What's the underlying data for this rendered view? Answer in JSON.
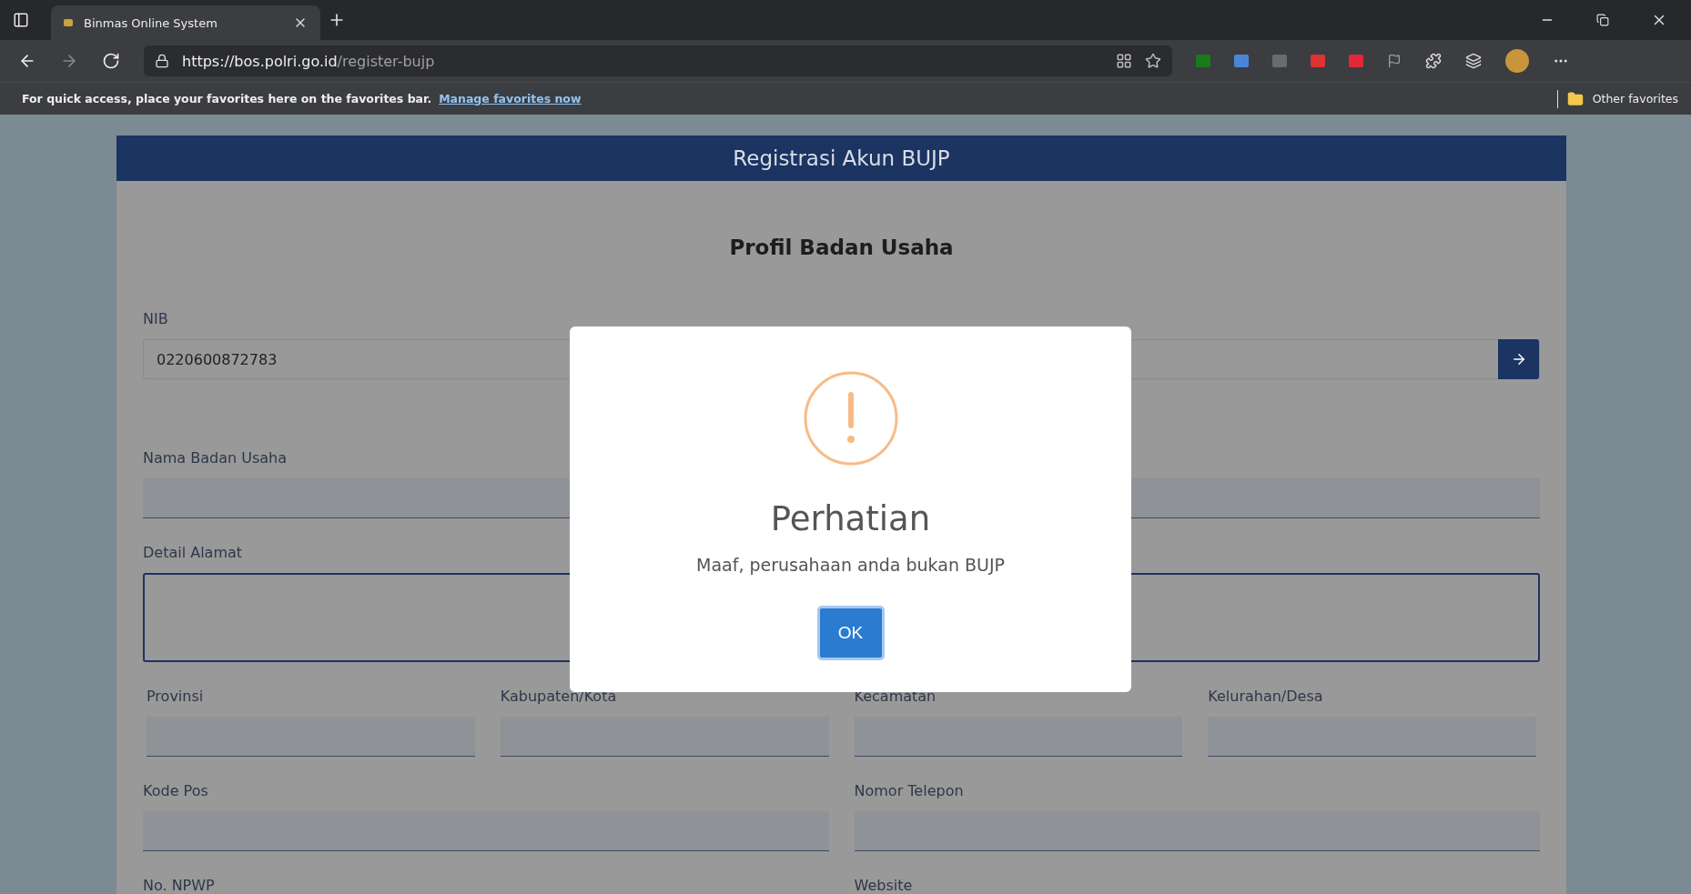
{
  "browser": {
    "tab": {
      "title": "Binmas Online System",
      "selected": true
    },
    "url_host": "https://bos.polri.go.id",
    "url_path": "/register-bujp",
    "favorites_message": "For quick access, place your favorites here on the favorites bar.",
    "favorites_link": "Manage favorites now",
    "other_favorites": "Other favorites"
  },
  "page": {
    "header": "Registrasi Akun BUJP",
    "section_title": "Profil Badan Usaha",
    "rows": [
      {
        "fields": [
          {
            "kind": "input-with-button",
            "label": "NIB",
            "value": "0220600872783"
          }
        ]
      },
      {
        "fields": [
          {
            "kind": "underlined",
            "label": "Nama Badan Usaha"
          }
        ]
      },
      {
        "fields": [
          {
            "kind": "textarea",
            "label": "Detail Alamat"
          }
        ]
      },
      {
        "fields": [
          {
            "kind": "underlined",
            "label": "Provinsi"
          },
          {
            "kind": "underlined",
            "label": "Kabupaten/Kota"
          },
          {
            "kind": "underlined",
            "label": "Kecamatan"
          },
          {
            "kind": "underlined",
            "label": "Kelurahan/Desa"
          }
        ]
      },
      {
        "fields": [
          {
            "kind": "underlined",
            "label": "Kode Pos"
          },
          {
            "kind": "underlined",
            "label": "Nomor Telepon"
          }
        ]
      },
      {
        "fields": [
          {
            "kind": "label-only",
            "label": "No. NPWP"
          },
          {
            "kind": "label-only",
            "label": "Website"
          }
        ]
      }
    ]
  },
  "dialog": {
    "title": "Perhatian",
    "message": "Maaf, perusahaan anda bukan BUJP",
    "button": "OK"
  }
}
